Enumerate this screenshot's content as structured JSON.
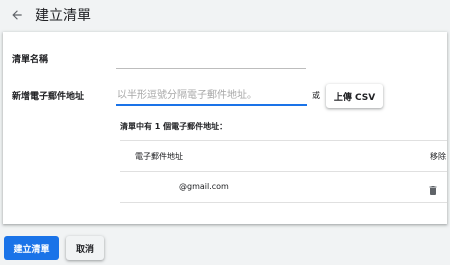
{
  "header": {
    "back_icon": "arrow-left-icon",
    "title": "建立清單"
  },
  "form": {
    "list_name": {
      "label": "清單名稱",
      "value": "",
      "placeholder": ""
    },
    "new_email": {
      "label": "新增電子郵件地址",
      "value": "",
      "placeholder": "以半形逗號分隔電子郵件地址。"
    },
    "or_text": "或",
    "upload_csv_label": "上傳 CSV"
  },
  "email_list": {
    "summary": "清單中有 1 個電子郵件地址：",
    "columns": {
      "email": "電子郵件地址",
      "remove": "移除"
    },
    "rows": [
      {
        "email": "@gmail.com",
        "remove_icon": "trash-icon"
      }
    ]
  },
  "footer": {
    "create_label": "建立清單",
    "cancel_label": "取消"
  },
  "colors": {
    "accent": "#1a73e8",
    "background": "#f1f3f4",
    "card": "#ffffff"
  }
}
